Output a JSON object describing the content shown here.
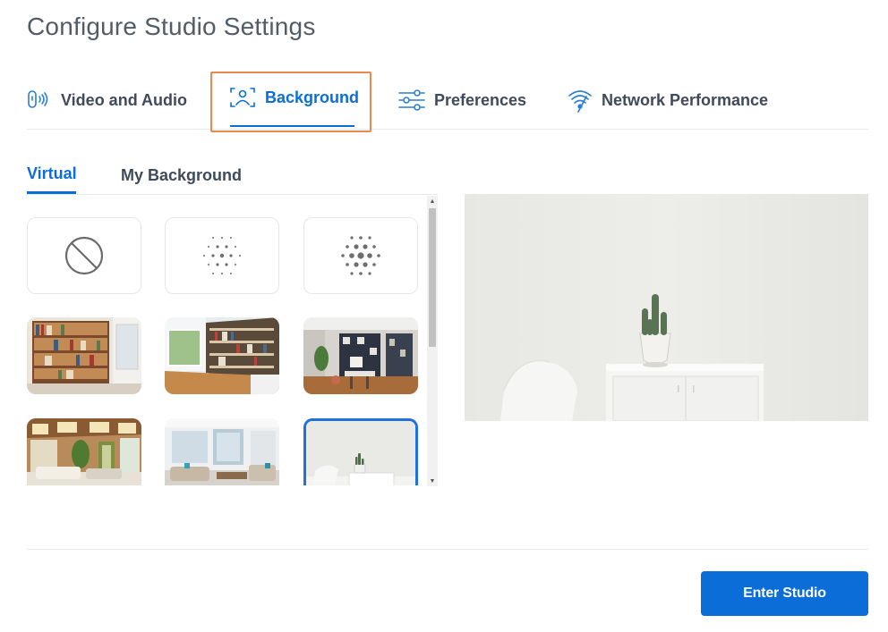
{
  "page": {
    "title": "Configure Studio Settings"
  },
  "tabs": [
    {
      "label": "Video and Audio",
      "icon": "video-audio-icon"
    },
    {
      "label": "Background",
      "icon": "background-person-icon",
      "active": true
    },
    {
      "label": "Preferences",
      "icon": "sliders-icon"
    },
    {
      "label": "Network Performance",
      "icon": "wifi-icon"
    }
  ],
  "subtabs": [
    {
      "label": "Virtual",
      "active": true
    },
    {
      "label": "My Background"
    }
  ],
  "backgrounds": {
    "options": [
      {
        "icon": "no-background-icon"
      },
      {
        "icon": "slight-blur-icon"
      },
      {
        "icon": "strong-blur-icon"
      },
      {
        "image": "bookshelf-wall"
      },
      {
        "image": "library-room"
      },
      {
        "image": "modern-office"
      },
      {
        "image": "sunroom-lounge"
      },
      {
        "image": "bright-living-room"
      },
      {
        "image": "plant-on-cabinet",
        "selected": true
      }
    ]
  },
  "colors": {
    "accent": "#0b6ed8",
    "highlight": "#e98a4c"
  },
  "footer": {
    "enter_label": "Enter Studio"
  }
}
